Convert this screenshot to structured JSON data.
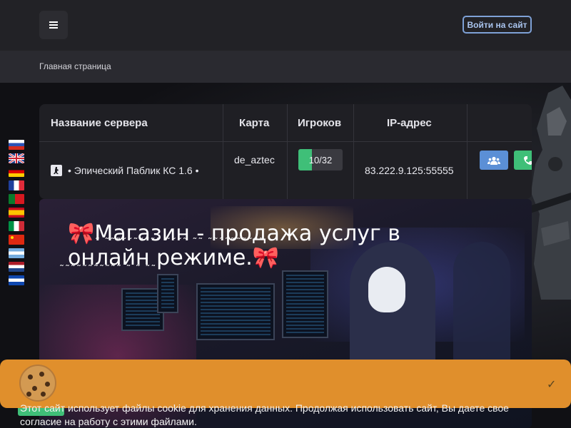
{
  "header": {
    "menu_icon": "hamburger-icon",
    "login_label": "Войти на сайт"
  },
  "breadcrumb": {
    "home": "Главная страница"
  },
  "servers": {
    "headers": [
      "Название сервера",
      "Карта",
      "Игроков",
      "IP-адрес"
    ],
    "rows": [
      {
        "icon": "cs-player-icon",
        "name": "• Эпический Паблик КС 1.6 •",
        "map": "de_aztec",
        "players": "10/32",
        "players_fraction": 0.3125,
        "ip": "83.222.9.125:55555",
        "actions": [
          "users-icon",
          "connect-icon"
        ]
      }
    ],
    "colors": {
      "players_fill": "#3fbf78",
      "users_button": "#5b8fd6",
      "connect_button": "#3fbf78"
    }
  },
  "language_flags": [
    "ru",
    "gb",
    "de",
    "fr",
    "pt",
    "es",
    "it",
    "cn",
    "ar",
    "nl",
    "sv"
  ],
  "shop": {
    "title": "Магазин - продажа услуг в онлайн режиме.",
    "bow_icon": "🎀"
  },
  "cookie_banner": {
    "text": "Этот сайт использует файлы cookie для хранения данных. Продолжая использовать сайт, Вы даете свое согласие на работу с этими файлами.",
    "accept_icon": "check-icon",
    "accept_glyph": "✓",
    "image": "cookie-icon"
  }
}
